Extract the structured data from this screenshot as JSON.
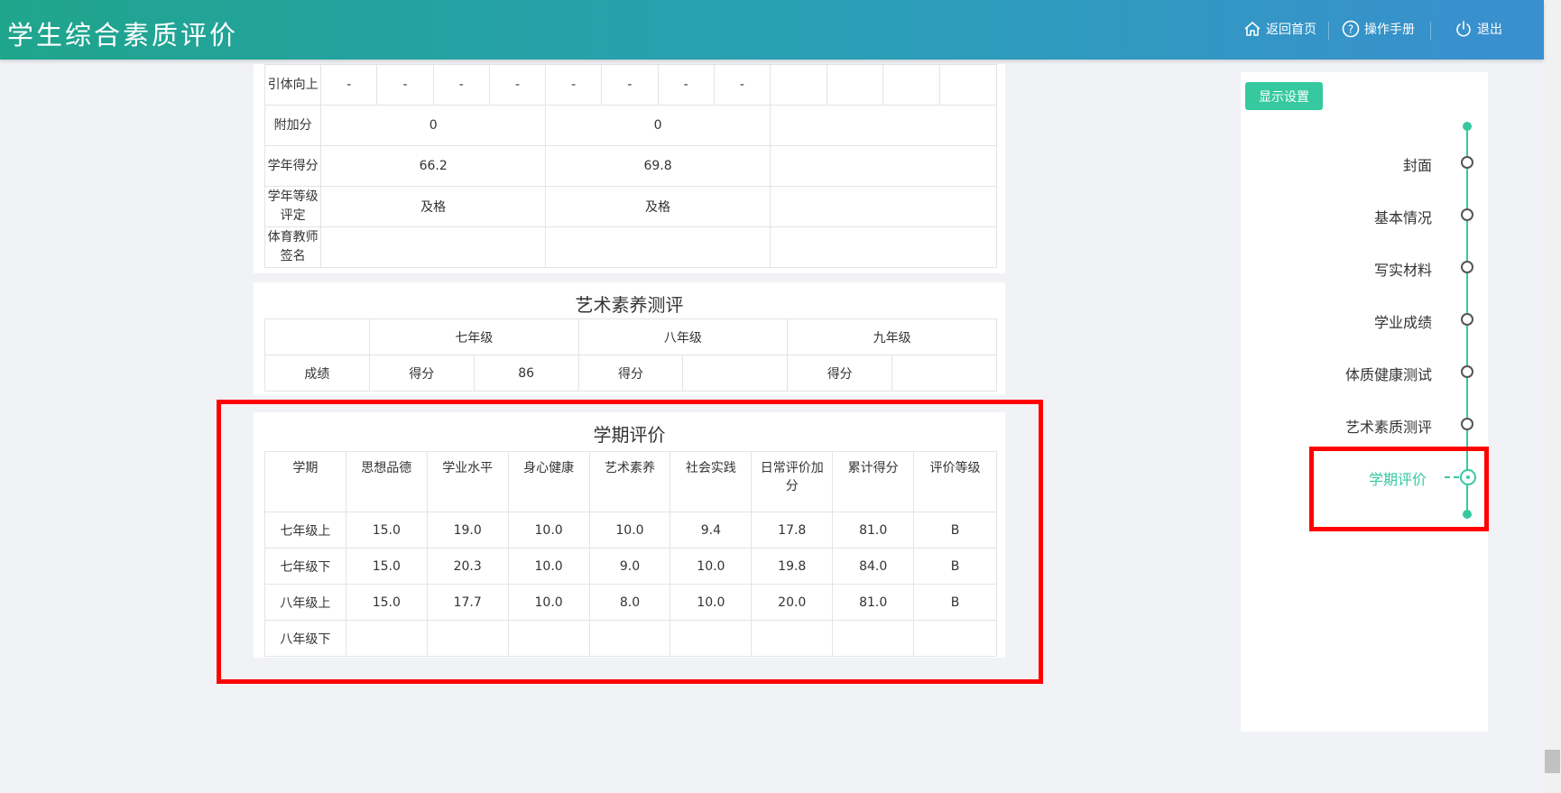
{
  "header": {
    "title": "学生综合素质评价",
    "nav": {
      "home": "返回首页",
      "manual": "操作手册",
      "logout": "退出"
    }
  },
  "pe_section": {
    "rows": [
      {
        "label": "引体向上",
        "values": [
          "-",
          "-",
          "-",
          "-",
          "-",
          "-",
          "-",
          "-",
          "",
          "",
          "",
          ""
        ]
      },
      {
        "label": "附加分",
        "values": [
          "0",
          "0",
          ""
        ]
      },
      {
        "label": "学年得分",
        "values": [
          "66.2",
          "69.8",
          ""
        ]
      },
      {
        "label": "学年等级评定",
        "values": [
          "及格",
          "及格",
          ""
        ]
      },
      {
        "label": "体育教师签名",
        "values": [
          "",
          "",
          ""
        ]
      }
    ]
  },
  "art_section": {
    "title": "艺术素养测评",
    "grades": [
      "七年级",
      "八年级",
      "九年级"
    ],
    "row_label": "成绩",
    "score_label": "得分",
    "scores": [
      "86",
      "",
      ""
    ]
  },
  "term_section": {
    "title": "学期评价",
    "headers": [
      "学期",
      "思想品德",
      "学业水平",
      "身心健康",
      "艺术素养",
      "社会实践",
      "日常评价加分",
      "累计得分",
      "评价等级"
    ],
    "rows": [
      [
        "七年级上",
        "15.0",
        "19.0",
        "10.0",
        "10.0",
        "9.4",
        "17.8",
        "81.0",
        "B"
      ],
      [
        "七年级下",
        "15.0",
        "20.3",
        "10.0",
        "9.0",
        "10.0",
        "19.8",
        "84.0",
        "B"
      ],
      [
        "八年级上",
        "15.0",
        "17.7",
        "10.0",
        "8.0",
        "10.0",
        "20.0",
        "81.0",
        "B"
      ],
      [
        "八年级下",
        "",
        "",
        "",
        "",
        "",
        "",
        "",
        ""
      ]
    ]
  },
  "right_nav": {
    "settings_button": "显示设置",
    "items": [
      "封面",
      "基本情况",
      "写实材料",
      "学业成绩",
      "体质健康测试",
      "艺术素质测评",
      "学期评价"
    ],
    "active_index": 6
  },
  "colors": {
    "accent": "#36c9a0",
    "highlight": "#ff0000",
    "header_start": "#1fa58c",
    "header_end": "#3a8fcf"
  }
}
